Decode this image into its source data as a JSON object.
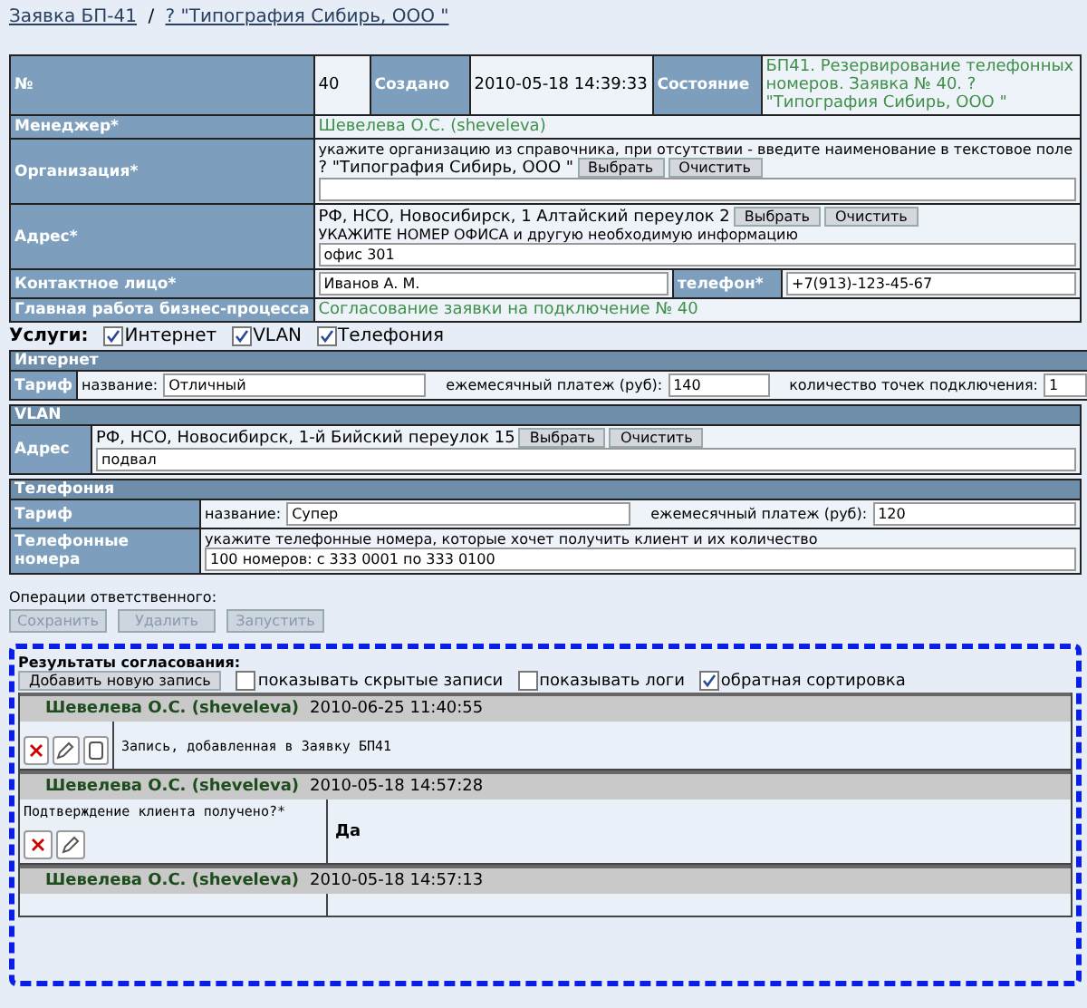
{
  "breadcrumb": [
    {
      "text": "Заявка БП-41"
    },
    {
      "text": "? \"Типография Сибирь, ООО \""
    }
  ],
  "breadcrumb_separator": "/",
  "header": {
    "number_label": "№",
    "number": "40",
    "created_label": "Создано",
    "created": "2010-05-18 14:39:33",
    "state_label": "Состояние",
    "state": "БП41. Резервирование телефонных номеров. Заявка № 40. ? \"Типография Сибирь, ООО \""
  },
  "manager": {
    "label": "Менеджер*",
    "value": "Шевелева О.С. (sheveleva)"
  },
  "organization": {
    "label": "Организация*",
    "hint": "укажите организацию из справочника, при отсутствии - введите наименование в текстовое поле",
    "value": "? \"Типография Сибирь, ООО \"",
    "buttons": [
      "Выбрать",
      "Очистить"
    ]
  },
  "address": {
    "label": "Адрес*",
    "value": "РФ, НСО, Новосибирск, 1 Алтайский переулок 2",
    "buttons": [
      "Выбрать",
      "Очистить"
    ],
    "hint": "УКАЖИТЕ НОМЕР ОФИСА и другую необходимую информацию",
    "detail": "офис 301"
  },
  "contact": {
    "label": "Контактное лицо*",
    "value": "Иванов А. М.",
    "phone_label": "телефон*",
    "phone": "+7(913)-123-45-67"
  },
  "main_work": {
    "label": "Главная работа бизнес-процесса",
    "value": "Согласование заявки на подключение № 40"
  },
  "services": {
    "label": "Услуги:",
    "items": [
      {
        "label": "Интернет",
        "checked": true
      },
      {
        "label": "VLAN",
        "checked": true
      },
      {
        "label": "Телефония",
        "checked": true
      }
    ]
  },
  "internet": {
    "title": "Интернет",
    "tariff_label": "Тариф",
    "fields": [
      {
        "label": "название:",
        "value": "Отличный"
      },
      {
        "label": "ежемесячный платеж (руб):",
        "value": "140"
      },
      {
        "label": "количество точек подключения:",
        "value": "1"
      }
    ]
  },
  "vlan": {
    "title": "VLAN",
    "address_label": "Адрес",
    "address": "РФ, НСО, Новосибирск, 1-й Бийский переулок 15",
    "buttons": [
      "Выбрать",
      "Очистить"
    ],
    "detail": "подвал"
  },
  "telephony": {
    "title": "Телефония",
    "tariff_label": "Тариф",
    "fields": [
      {
        "label": "название:",
        "value": "Супер"
      },
      {
        "label": "ежемесячный платеж (руб):",
        "value": "120"
      }
    ],
    "numbers_label": "Телефонные номера",
    "numbers_hint": "укажите телефонные номера, которые хочет получить клиент и их количество",
    "numbers": "100 номеров: с 333 0001 по 333 0100"
  },
  "operations": {
    "label": "Операции ответственного:",
    "buttons": [
      {
        "label": "Сохранить",
        "disabled": true
      },
      {
        "label": "Удалить",
        "disabled": true
      },
      {
        "label": "Запустить",
        "disabled": true
      }
    ]
  },
  "results": {
    "title": "Результаты согласования:",
    "add_button": "Добавить новую запись",
    "options": [
      {
        "label": "показывать скрытые записи",
        "checked": false
      },
      {
        "label": "показывать логи",
        "checked": false
      },
      {
        "label": "обратная сортировка",
        "checked": true
      }
    ],
    "records": [
      {
        "author": "Шевелева О.С. (sheveleva)",
        "time": "2010-06-25 11:40:55",
        "kind": "note",
        "text": "Запись, добавленная в Заявку БП41",
        "actions": [
          {
            "kind": "delete"
          },
          {
            "kind": "edit"
          },
          {
            "kind": "view"
          }
        ]
      },
      {
        "author": "Шевелева О.С. (sheveleva)",
        "time": "2010-05-18 14:57:28",
        "kind": "question",
        "question": "Подтверждение клиента получено?*",
        "answer": "Да",
        "actions": [
          {
            "kind": "delete"
          },
          {
            "kind": "edit"
          }
        ]
      },
      {
        "author": "Шевелева О.С. (sheveleva)",
        "time": "2010-05-18 14:57:13",
        "kind": "cut"
      }
    ]
  }
}
